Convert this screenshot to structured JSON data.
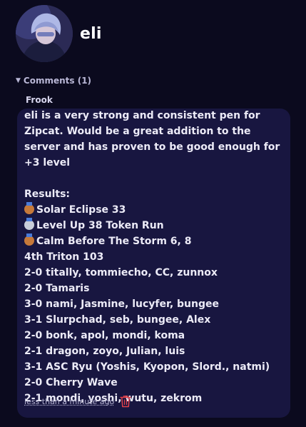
{
  "profile": {
    "username": "eli"
  },
  "comments": {
    "toggle_label": "Comments (1)",
    "items": [
      {
        "author": "Frook",
        "intro": "eli is a very strong and consistent pen for Zipcat. Would be a great addition to the server and has proven to be good enough for +3 level",
        "results_heading": "Results:",
        "medal_lines": [
          {
            "medal": "bronze-medal-icon",
            "text": "Solar Eclipse 33"
          },
          {
            "medal": "silver-medal-icon",
            "text": "Level Up 38 Token Run"
          },
          {
            "medal": "bronze-medal-icon",
            "text": "Calm Before The Storm 6, 8"
          }
        ],
        "lines": [
          "4th Triton 103",
          "2-0 titally, tommiecho, CC, zunnox",
          "2-0 Tamaris",
          "3-0 nami, Jasmine, lucyfer, bungee",
          "3-1 Slurpchad, seb, bungee, Alex",
          "2-0 bonk, apol, mondi, koma",
          "2-1 dragon, zoyo, Julian, luis",
          "3-1 ASC Ryu (Yoshis, Kyopon, Slord., natmi)",
          "2-0 Cherry Wave",
          "2-1 mondi, yoshi, wutu, zekrom"
        ],
        "timestamp": "less than a minute ago"
      }
    ]
  },
  "colors": {
    "background": "#0b0a1e",
    "card": "#181640",
    "delete": "#e0414b"
  }
}
